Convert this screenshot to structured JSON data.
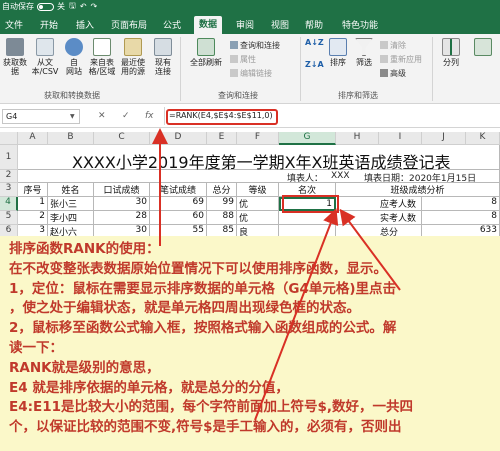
{
  "titlebar": {
    "autosave": "自动保存",
    "toggle": "关"
  },
  "tabs": [
    "文件",
    "开始",
    "插入",
    "页面布局",
    "公式",
    "数据",
    "审阅",
    "视图",
    "帮助",
    "特色功能"
  ],
  "active_tab": "数据",
  "ribbon": {
    "buttons": [
      "获取数\n据",
      "从文\n本/CSV",
      "自\n网站",
      "来自表\n格/区域",
      "最近使\n用的源",
      "现有\n连接",
      "全部刷新",
      "排序",
      "筛选",
      "分列"
    ],
    "small_items": [
      "查询和连接",
      "属性",
      "编辑链接",
      "清除",
      "重新应用",
      "高级"
    ],
    "groups": [
      "获取和转换数据",
      "查询和连接",
      "排序和筛选"
    ],
    "sort_asc": "A↓Z",
    "sort_desc": "Z↓A"
  },
  "formula_bar": {
    "name_box": "G4",
    "formula": "=RANK(E4,$E$4:$E$11,0)",
    "cancel": "✕",
    "enter": "✓",
    "fx": "fx"
  },
  "columns": [
    "A",
    "B",
    "C",
    "D",
    "E",
    "F",
    "G",
    "H",
    "I",
    "J",
    "K"
  ],
  "rows": [
    "1",
    "2",
    "3",
    "4",
    "5",
    "6",
    "7"
  ],
  "sheet": {
    "title": "XXXX小学2019年度第一学期X年X班英语成绩登记表",
    "filled_by_label": "填表人：",
    "filled_by": "XXX",
    "fill_date": "填表日期：2020年1月15日",
    "headers": [
      "序号",
      "姓名",
      "口试成绩",
      "笔试成绩",
      "总分",
      "等级",
      "名次"
    ],
    "analysis_title": "班级成绩分析",
    "data_rows": [
      {
        "no": "1",
        "name": "张小三",
        "oral": "30",
        "written": "69",
        "total": "99",
        "grade": "优",
        "rank": "1",
        "label": "应考人数",
        "value": "8"
      },
      {
        "no": "2",
        "name": "李小四",
        "oral": "28",
        "written": "60",
        "total": "88",
        "grade": "优",
        "rank": "",
        "label": "实考人数",
        "value": "8"
      },
      {
        "no": "3",
        "name": "赵小六",
        "oral": "30",
        "written": "55",
        "total": "85",
        "grade": "良",
        "rank": "",
        "label": "总分",
        "value": "633"
      },
      {
        "no": "4",
        "name": "赵辉",
        "oral": "25",
        "written": "55",
        "total": "80",
        "grade": "良",
        "rank": "",
        "label": "平均分",
        "value": "79.13"
      }
    ]
  },
  "note": [
    "排序函数RANK的使用：",
    "在不改变整张表数据原始位置情况下可以使用排序函数，显示。",
    "1，定位：鼠标在需要显示排序数据的单元格（G4单元格)里点击",
    "，使之处于编辑状态，就是单元格四周出现绿色框的状态。",
    "2，鼠标移至函数公式输入框，按照格式输入函数组成的公式。解",
    "读一下：",
    "RANK就是级别的意思，",
    "E4 就是排序依据的单元格，就是总分的分值，",
    "E4:E11是比较大小的范围，每个字符前面加上符号$,数好，一共四",
    "个，以保证比较的范围不变,符号$是手工输入的，必须有，否则出"
  ],
  "colors": {
    "excel_green": "#1f7145",
    "annotation_red": "#d93025",
    "note_bg": "#fbf8c9",
    "note_text": "#c0392b"
  }
}
